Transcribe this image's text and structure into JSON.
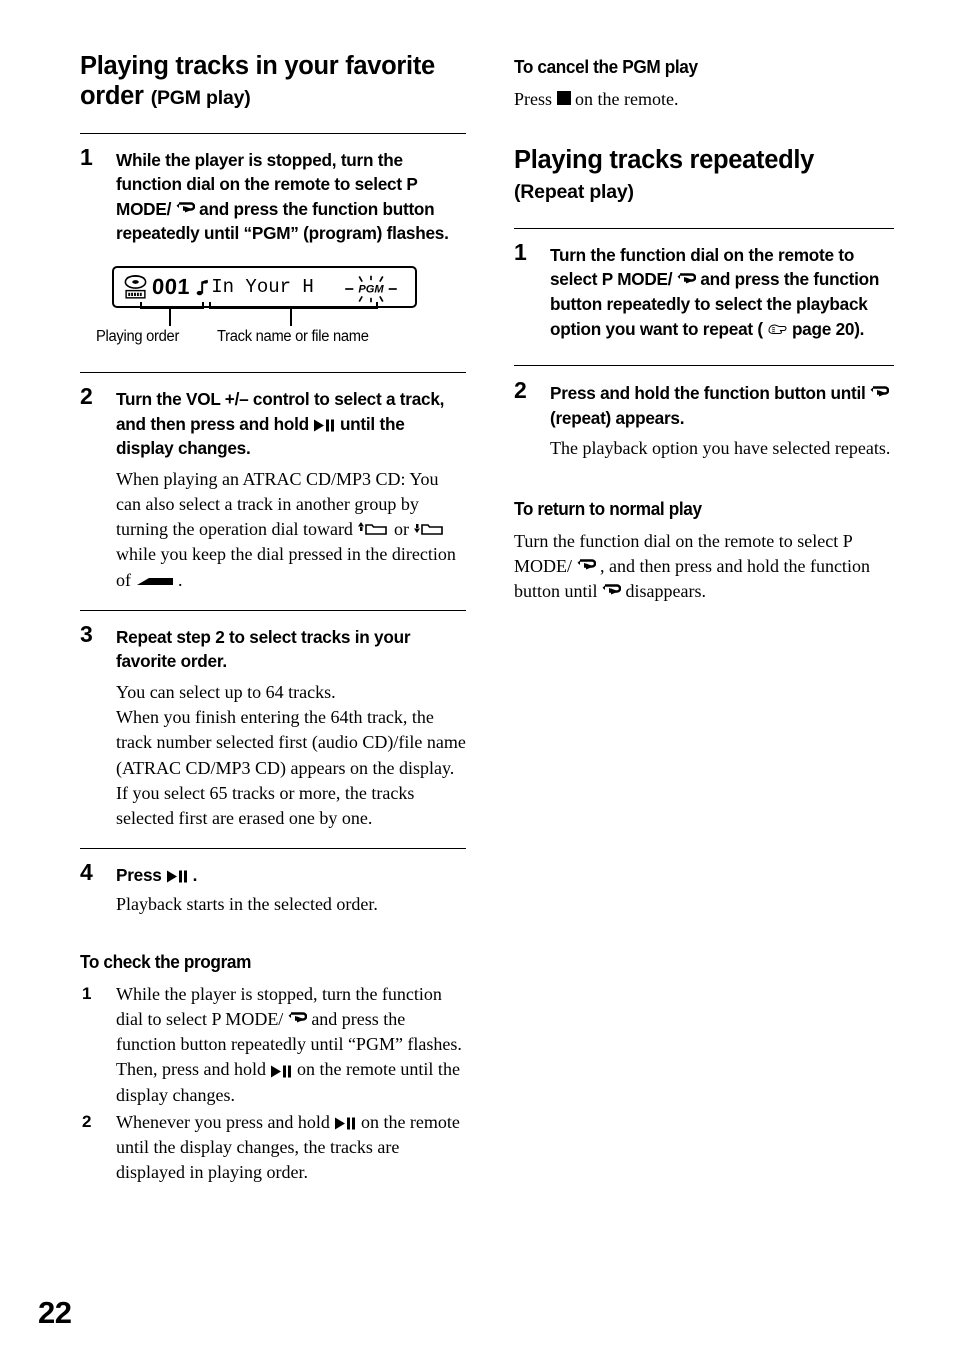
{
  "page": {
    "number": "22"
  },
  "left_column": {
    "title_main": "Playing tracks in your favorite order",
    "title_sub": "(PGM play)",
    "step1": {
      "num": "1",
      "head_part1": "While the player is stopped, turn the function dial on the remote to select P MODE/",
      "head_part2": " and press the function button repeatedly until “PGM” (program) flashes."
    },
    "figure": {
      "display": {
        "playing_order": "001",
        "track_text": "In Your H",
        "indicator": "PGM",
        "disc_icon": "disc-icon",
        "note_icon": "music-note-icon"
      },
      "caption_left": "Playing order",
      "caption_right": "Track name or file name"
    },
    "step2": {
      "num": "2",
      "head_part1": "Turn the VOL +/– control to select a track, and then press and hold ",
      "head_part2": " until the display changes.",
      "body_part1": "When playing an ATRAC CD/MP3 CD: You can also select a track in another group by turning the operation dial toward ",
      "body_or": " or ",
      "body_part2": " while you keep the dial pressed in the direction of ",
      "body_end": "."
    },
    "step3": {
      "num": "3",
      "head": "Repeat step 2 to select tracks in your favorite order.",
      "body": "You can select up to 64 tracks.\nWhen you finish entering the 64th track, the track number selected first (audio CD)/file name (ATRAC CD/MP3 CD) appears on the display.\nIf you select 65 tracks or more, the tracks selected first are erased one by one."
    },
    "step4": {
      "num": "4",
      "head_part1": "Press ",
      "head_part2": ".",
      "body": "Playback starts in the selected order."
    },
    "check_program": {
      "heading": "To check the program",
      "item1": {
        "num": "1",
        "part1": "While the player is stopped, turn the function dial to select P MODE/",
        "part2": " and press the function button repeatedly until “PGM” flashes. Then, press and hold ",
        "part3": " on the remote until the display changes."
      },
      "item2": {
        "num": "2",
        "part1": "Whenever you press and hold ",
        "part2": " on the remote until the display changes, the tracks are displayed in playing order."
      }
    }
  },
  "right_column": {
    "cancel_pgm": {
      "heading": "To cancel the PGM play",
      "text_part1": "Press ",
      "text_part2": " on the remote."
    },
    "title_main": "Playing tracks repeatedly",
    "title_sub": "(Repeat play)",
    "step1": {
      "num": "1",
      "head_part1": "Turn the function dial on the remote to select P MODE/",
      "head_part2": " and press the function button repeatedly to select the playback option you want to repeat (",
      "head_part3": " page 20)."
    },
    "step2": {
      "num": "2",
      "head_part1": "Press and hold the function button until ",
      "head_part2": " (repeat) appears.",
      "body": "The playback option you have selected repeats."
    },
    "normal_play": {
      "heading": "To return to normal play",
      "part1": "Turn the function dial on the remote to select P MODE/",
      "part2": ", and then press and hold the function button until ",
      "part3": " disappears."
    }
  },
  "icons": {
    "repeat": "repeat-icon",
    "play_pause": "play-pause-icon",
    "stop": "stop-icon",
    "group_up": "group-up-folder-icon",
    "group_down": "group-down-folder-icon",
    "enter_wedge": "enter-direction-icon",
    "pointing_hand": "pointing-hand-icon"
  },
  "colors": {
    "text": "#000000",
    "background": "#ffffff"
  }
}
